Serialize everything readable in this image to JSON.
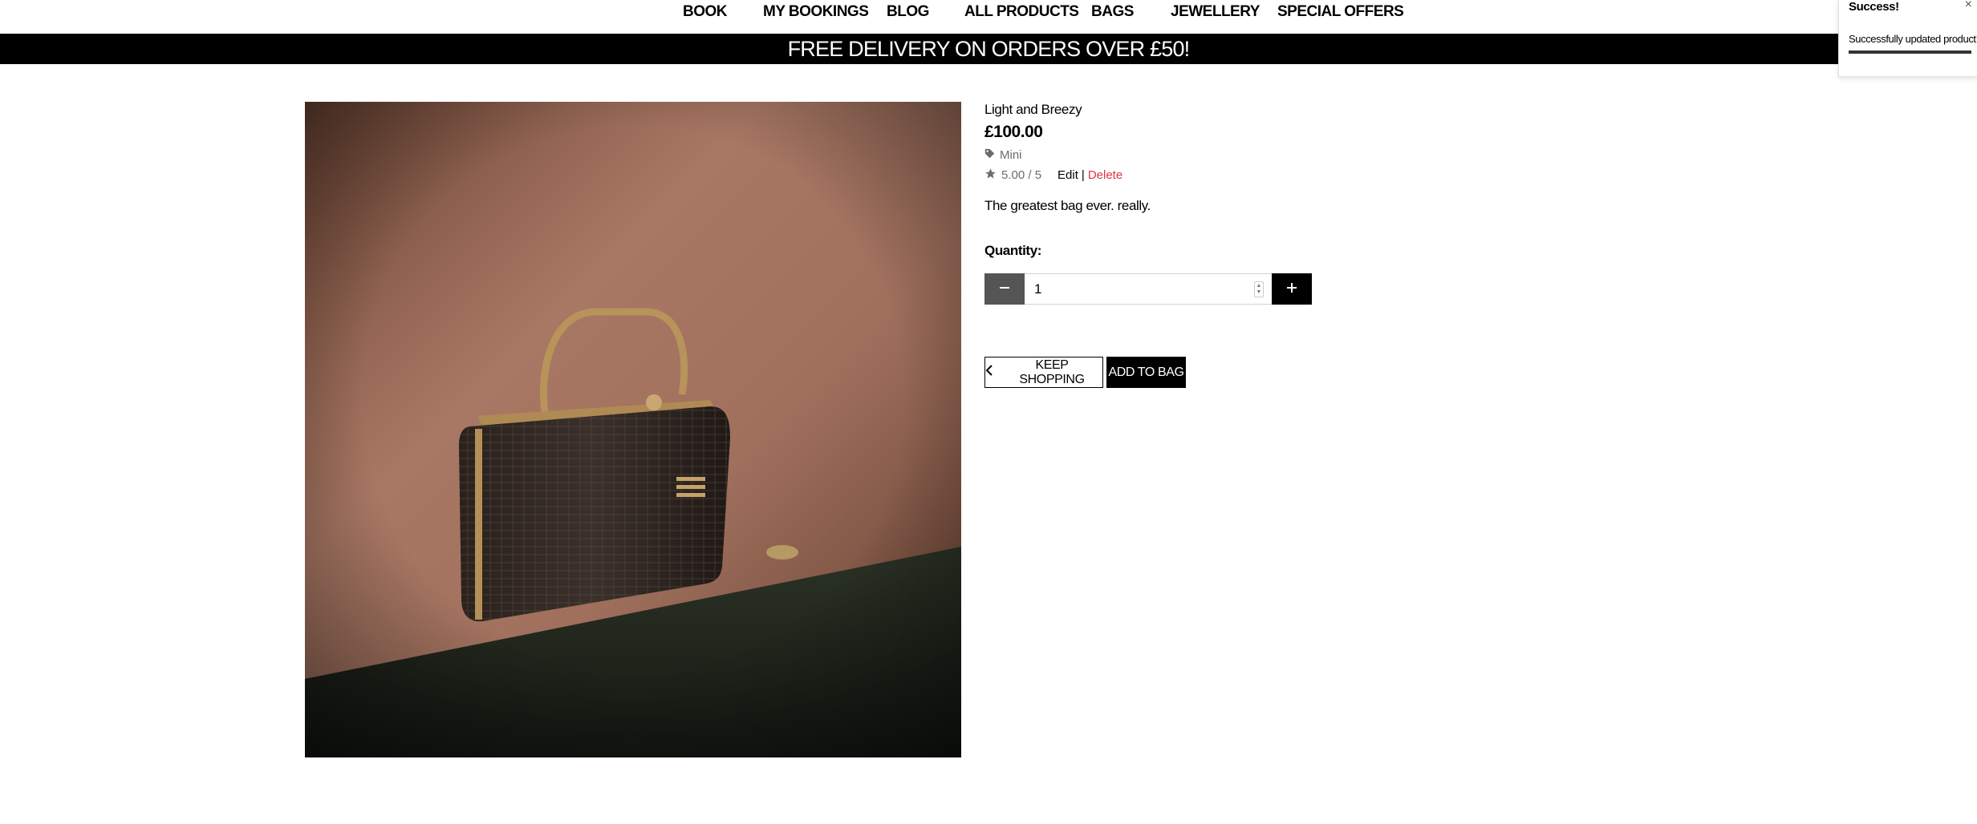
{
  "nav": {
    "items": [
      {
        "label": "BOOK"
      },
      {
        "label": "MY BOOKINGS"
      },
      {
        "label": "BLOG"
      },
      {
        "label": "ALL PRODUCTS"
      },
      {
        "label": "BAGS"
      },
      {
        "label": "JEWELLERY"
      },
      {
        "label": "SPECIAL OFFERS"
      }
    ]
  },
  "banner": {
    "text": "FREE DELIVERY ON ORDERS OVER £50!"
  },
  "product": {
    "name": "Light and Breezy",
    "price": "£100.00",
    "category": "Mini",
    "rating": "5.00 / 5",
    "edit_label": "Edit",
    "separator": "|",
    "delete_label": "Delete",
    "description": "The greatest bag ever. really.",
    "quantity_label": "Quantity:",
    "quantity_value": "1",
    "keep_shopping_label": "KEEP SHOPPING",
    "add_to_bag_label": "ADD TO BAG"
  },
  "toast": {
    "title": "Success!",
    "close": "×",
    "message": "Successfully updated product!"
  },
  "colors": {
    "banner_bg": "#000000",
    "delete_link": "#dc3545",
    "minus_button": "#555555",
    "plus_button": "#000000",
    "muted_text": "#6c6c6c"
  },
  "icons": [
    "tag-icon",
    "star-icon",
    "minus-icon",
    "plus-icon",
    "chevron-left-icon",
    "close-icon"
  ]
}
